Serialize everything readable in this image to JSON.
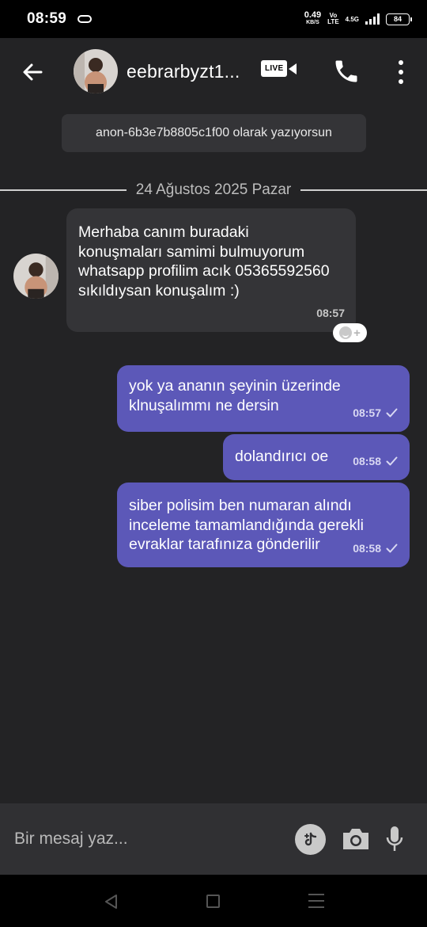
{
  "status_bar": {
    "time": "08:59",
    "net_speed_value": "0.49",
    "net_speed_unit": "KB/S",
    "volte_top": "Vo",
    "volte_bottom": "LTE",
    "network": "4.5G",
    "battery": "84"
  },
  "header": {
    "contact_name": "eebrarbyzt1...",
    "live_label": "LIVE",
    "icons": [
      "back-arrow-icon",
      "avatar",
      "live-video-icon",
      "phone-icon",
      "more-vertical-icon"
    ]
  },
  "anon_notice": "anon-6b3e7b8805c1f00 olarak yazıyorsun",
  "date_divider": "24 Ağustos 2025 Pazar",
  "messages": [
    {
      "direction": "incoming",
      "text": "Merhaba canım buradaki konuşmaları samimi bulmuyorum whatsapp profilim acık 05365592560 sıkıldıysan konuşalım :)",
      "time": "08:57"
    },
    {
      "direction": "outgoing",
      "text": "yok ya ananın şeyinin üzerinde klnuşalımmı ne dersin",
      "time": "08:57",
      "status": "sent"
    },
    {
      "direction": "outgoing",
      "text": "dolandırıcı oe",
      "time": "08:58",
      "status": "sent"
    },
    {
      "direction": "outgoing",
      "text": "siber polisim ben numaran alındı inceleme tamamlandığında gerekli evraklar tarafınıza gönderilir",
      "time": "08:58",
      "status": "sent"
    }
  ],
  "composer": {
    "placeholder": "Bir mesaj yaz...",
    "icons": [
      "sticker-icon",
      "camera-icon",
      "microphone-icon"
    ]
  },
  "colors": {
    "background": "#232325",
    "incoming_bubble": "#343437",
    "outgoing_bubble": "#5c58b8",
    "composer": "#303033"
  }
}
